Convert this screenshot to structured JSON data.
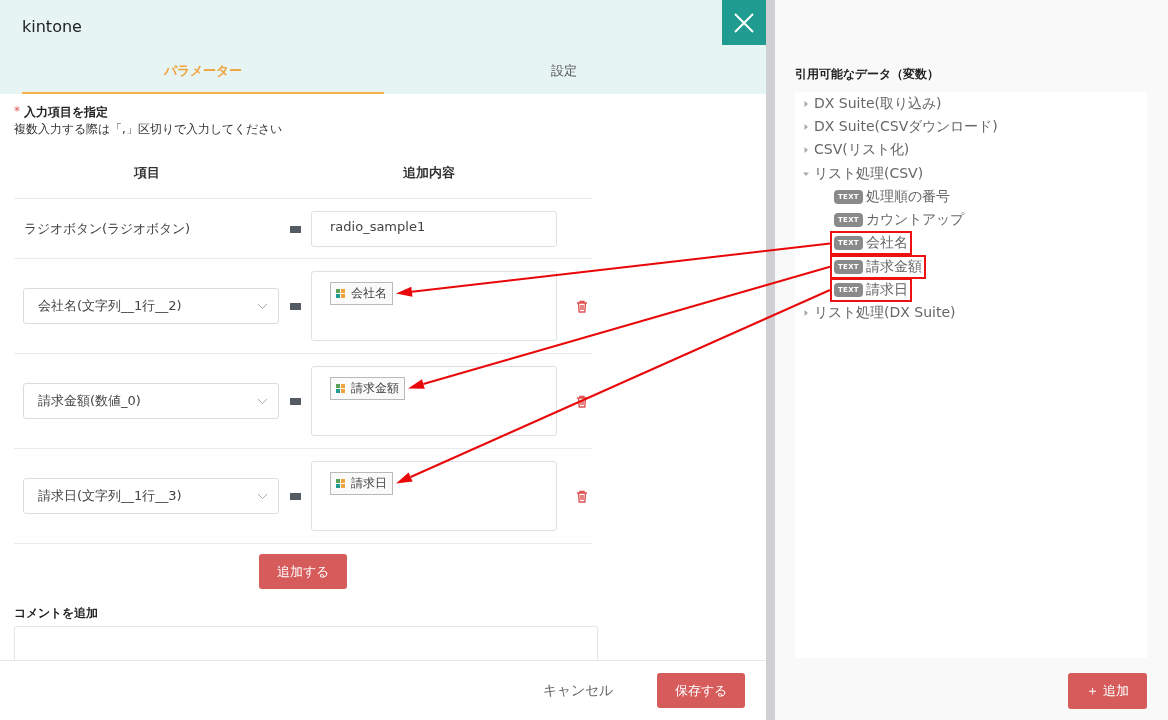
{
  "window": {
    "title": "kintone"
  },
  "tabs": [
    {
      "label": "パラメーター",
      "selected": true
    },
    {
      "label": "設定",
      "selected": false
    }
  ],
  "section": {
    "required_mark": "*",
    "title": "入力項目を指定",
    "hint": "複数入力する際は「,」区切りで入力してください"
  },
  "columns": [
    "項目",
    "追加内容"
  ],
  "rows": [
    {
      "kind": "fixed",
      "field": "ラジオボタン(ラジオボタン)",
      "value": "radio_sample1"
    },
    {
      "kind": "select",
      "field": "会社名(文字列__1行__2)",
      "chip": "会社名"
    },
    {
      "kind": "select",
      "field": "請求金額(数値_0)",
      "chip": "請求金額"
    },
    {
      "kind": "select",
      "field": "請求日(文字列__1行__3)",
      "chip": "請求日"
    }
  ],
  "add_row_button": "追加する",
  "comment": {
    "label": "コメントを追加"
  },
  "footer": {
    "cancel": "キャンセル",
    "save": "保存する"
  },
  "variables": {
    "title": "引用可能なデータ（変数）",
    "tree": [
      {
        "label": "DX Suite(取り込み)",
        "expanded": false
      },
      {
        "label": "DX Suite(CSVダウンロード)",
        "expanded": false
      },
      {
        "label": "CSV(リスト化)",
        "expanded": false
      },
      {
        "label": "リスト処理(CSV)",
        "expanded": true,
        "children": [
          {
            "badge": "TEXT",
            "label": "処理順の番号",
            "highlighted": false
          },
          {
            "badge": "TEXT",
            "label": "カウントアップ",
            "highlighted": false
          },
          {
            "badge": "TEXT",
            "label": "会社名",
            "highlighted": true
          },
          {
            "badge": "TEXT",
            "label": "請求金額",
            "highlighted": true
          },
          {
            "badge": "TEXT",
            "label": "請求日",
            "highlighted": true
          }
        ]
      },
      {
        "label": "リスト処理(DX Suite)",
        "expanded": false
      }
    ],
    "add_button": "＋ 追加"
  }
}
